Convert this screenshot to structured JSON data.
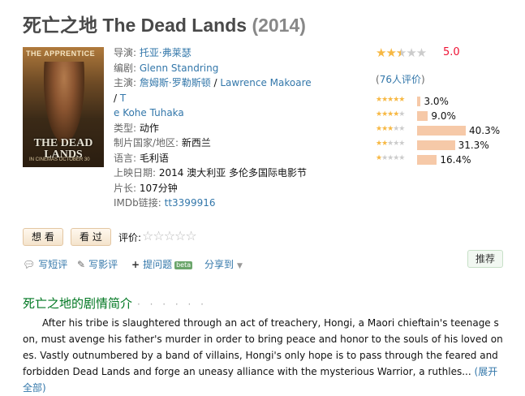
{
  "title": {
    "cn": "死亡之地",
    "en": "The Dead Lands",
    "year": "(2014)"
  },
  "poster": {
    "top_text": "THE APPRENTICE",
    "title_text": "THE DEAD LANDS",
    "bottom_text": "IN CINEMAS OCTOBER 30"
  },
  "info": {
    "director_label": "导演:",
    "director": "托亚·弗莱瑟",
    "writer_label": "编剧:",
    "writer": "Glenn Standring",
    "cast_label": "主演:",
    "cast_1": "詹姆斯·罗勒斯顿",
    "cast_sep_1": " / ",
    "cast_2": "Lawrence Makoare",
    "cast_sep_2": " / ",
    "cast_3a": "T",
    "cast_3b": "e Kohe Tuhaka",
    "genre_label": "类型:",
    "genre": "动作",
    "country_label": "制片国家/地区:",
    "country": "新西兰",
    "language_label": "语言:",
    "language": "毛利语",
    "release_label": "上映日期:",
    "release": "2014 澳大利亚 多伦多国际电影节",
    "runtime_label": "片长:",
    "runtime": "107分钟",
    "imdb_label": "IMDb链接:",
    "imdb": "tt3399916"
  },
  "rating": {
    "score": "5.0",
    "stars_value": 2.5,
    "votes_open": "(",
    "votes": "76人评价",
    "votes_close": ")",
    "distribution": [
      {
        "stars": 5,
        "percent": 3.0,
        "label": "3.0%"
      },
      {
        "stars": 4,
        "percent": 9.0,
        "label": "9.0%"
      },
      {
        "stars": 3,
        "percent": 40.3,
        "label": "40.3%"
      },
      {
        "stars": 2,
        "percent": 31.3,
        "label": "31.3%"
      },
      {
        "stars": 1,
        "percent": 16.4,
        "label": "16.4%"
      }
    ]
  },
  "buttons": {
    "want": "想 看",
    "seen": "看 过",
    "evaluate_label": "评价:"
  },
  "actions": {
    "short_review": "写短评",
    "review": "写影评",
    "ask": "提问题",
    "beta": "beta",
    "share": "分享到",
    "recommend": "推荐"
  },
  "synopsis": {
    "heading": "死亡之地的剧情简介",
    "dots": "· · · · · ·",
    "text": "After his tribe is slaughtered through an act of treachery, Hongi, a Maori chieftain's teenage son, must avenge his father's murder in order to bring peace and honor to the souls of his loved ones. Vastly outnumbered by a band of villains, Hongi's only hope is to pass through the feared and forbidden Dead Lands and forge an uneasy alliance with the mysterious Warrior, a ruthles...",
    "more": "(展开全部)"
  },
  "colors": {
    "link": "#3377aa",
    "star": "#f7b843",
    "score": "#ee1133",
    "heading_green": "#007722",
    "bar": "#f6c9a8"
  }
}
